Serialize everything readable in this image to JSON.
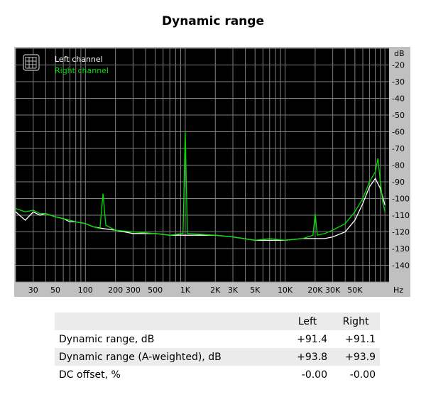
{
  "chart_data": {
    "type": "line",
    "title": "Dynamic range",
    "xscale": "log",
    "xlim": [
      20,
      110000
    ],
    "ylim": [
      -150,
      -10
    ],
    "yunit": "dB",
    "xunit": "Hz",
    "grid": true,
    "legend_position": "top-left",
    "y_ticks": [
      -20,
      -30,
      -40,
      -50,
      -60,
      -70,
      -80,
      -90,
      -100,
      -110,
      -120,
      -130,
      -140
    ],
    "y_tick_labels": [
      "-20",
      "-30",
      "-40",
      "-50",
      "-60",
      "-70",
      "-80",
      "-90",
      "-100",
      "-110",
      "-120",
      "-130",
      "-140"
    ],
    "x_ticks": [
      30,
      50,
      100,
      200,
      300,
      500,
      1000,
      2000,
      3000,
      5000,
      10000,
      20000,
      30000,
      50000
    ],
    "x_tick_labels": [
      "30",
      "50",
      "100",
      "200",
      "300",
      "500",
      "1K",
      "2K",
      "3K",
      "5K",
      "10K",
      "20K",
      "30K",
      "50K"
    ],
    "series": [
      {
        "name": "Left channel",
        "color": "#ffffff",
        "x": [
          20,
          25,
          30,
          35,
          40,
          50,
          60,
          70,
          80,
          100,
          120,
          150,
          200,
          300,
          500,
          700,
          1000,
          2000,
          3000,
          5000,
          7000,
          10000,
          15000,
          20000,
          25000,
          30000,
          40000,
          50000,
          60000,
          70000,
          80000,
          90000,
          100000
        ],
        "y": [
          -108,
          -113,
          -108,
          -110,
          -109,
          -111,
          -112,
          -114,
          -114,
          -115,
          -117,
          -118,
          -119,
          -121,
          -121,
          -122,
          -122,
          -122,
          -123,
          -125,
          -125,
          -125,
          -124,
          -124,
          -124,
          -123,
          -120,
          -113,
          -103,
          -93,
          -88,
          -94,
          -104
        ]
      },
      {
        "name": "Right channel",
        "color": "#00e000",
        "x": [
          20,
          25,
          30,
          35,
          40,
          50,
          60,
          70,
          80,
          100,
          120,
          140,
          150,
          160,
          200,
          300,
          500,
          700,
          950,
          1000,
          1050,
          2000,
          3000,
          5000,
          7000,
          10000,
          15000,
          19000,
          20000,
          21000,
          25000,
          30000,
          40000,
          50000,
          60000,
          70000,
          80000,
          85000,
          90000,
          95000,
          100000
        ],
        "y": [
          -106,
          -108,
          -107,
          -109,
          -109,
          -111,
          -112,
          -113,
          -114,
          -115,
          -117,
          -118,
          -97,
          -116,
          -119,
          -120,
          -121,
          -122,
          -121,
          -60,
          -121,
          -122,
          -123,
          -125,
          -124,
          -125,
          -124,
          -122,
          -109,
          -122,
          -121,
          -119,
          -115,
          -108,
          -100,
          -90,
          -84,
          -76,
          -90,
          -102,
          -108
        ]
      }
    ]
  },
  "axis_unit_top": "dB",
  "axis_unit_right": "Hz",
  "legend": [
    {
      "label": "Left channel",
      "color": "#ffffff"
    },
    {
      "label": "Right channel",
      "color": "#00e000"
    }
  ],
  "table": {
    "headers": [
      "",
      "Left",
      "Right"
    ],
    "rows": [
      {
        "label": "Dynamic range, dB",
        "left": "+91.4",
        "right": "+91.1"
      },
      {
        "label": "Dynamic range (A-weighted), dB",
        "left": "+93.8",
        "right": "+93.9"
      },
      {
        "label": "DC offset, %",
        "left": "-0.00",
        "right": "-0.00"
      }
    ]
  }
}
